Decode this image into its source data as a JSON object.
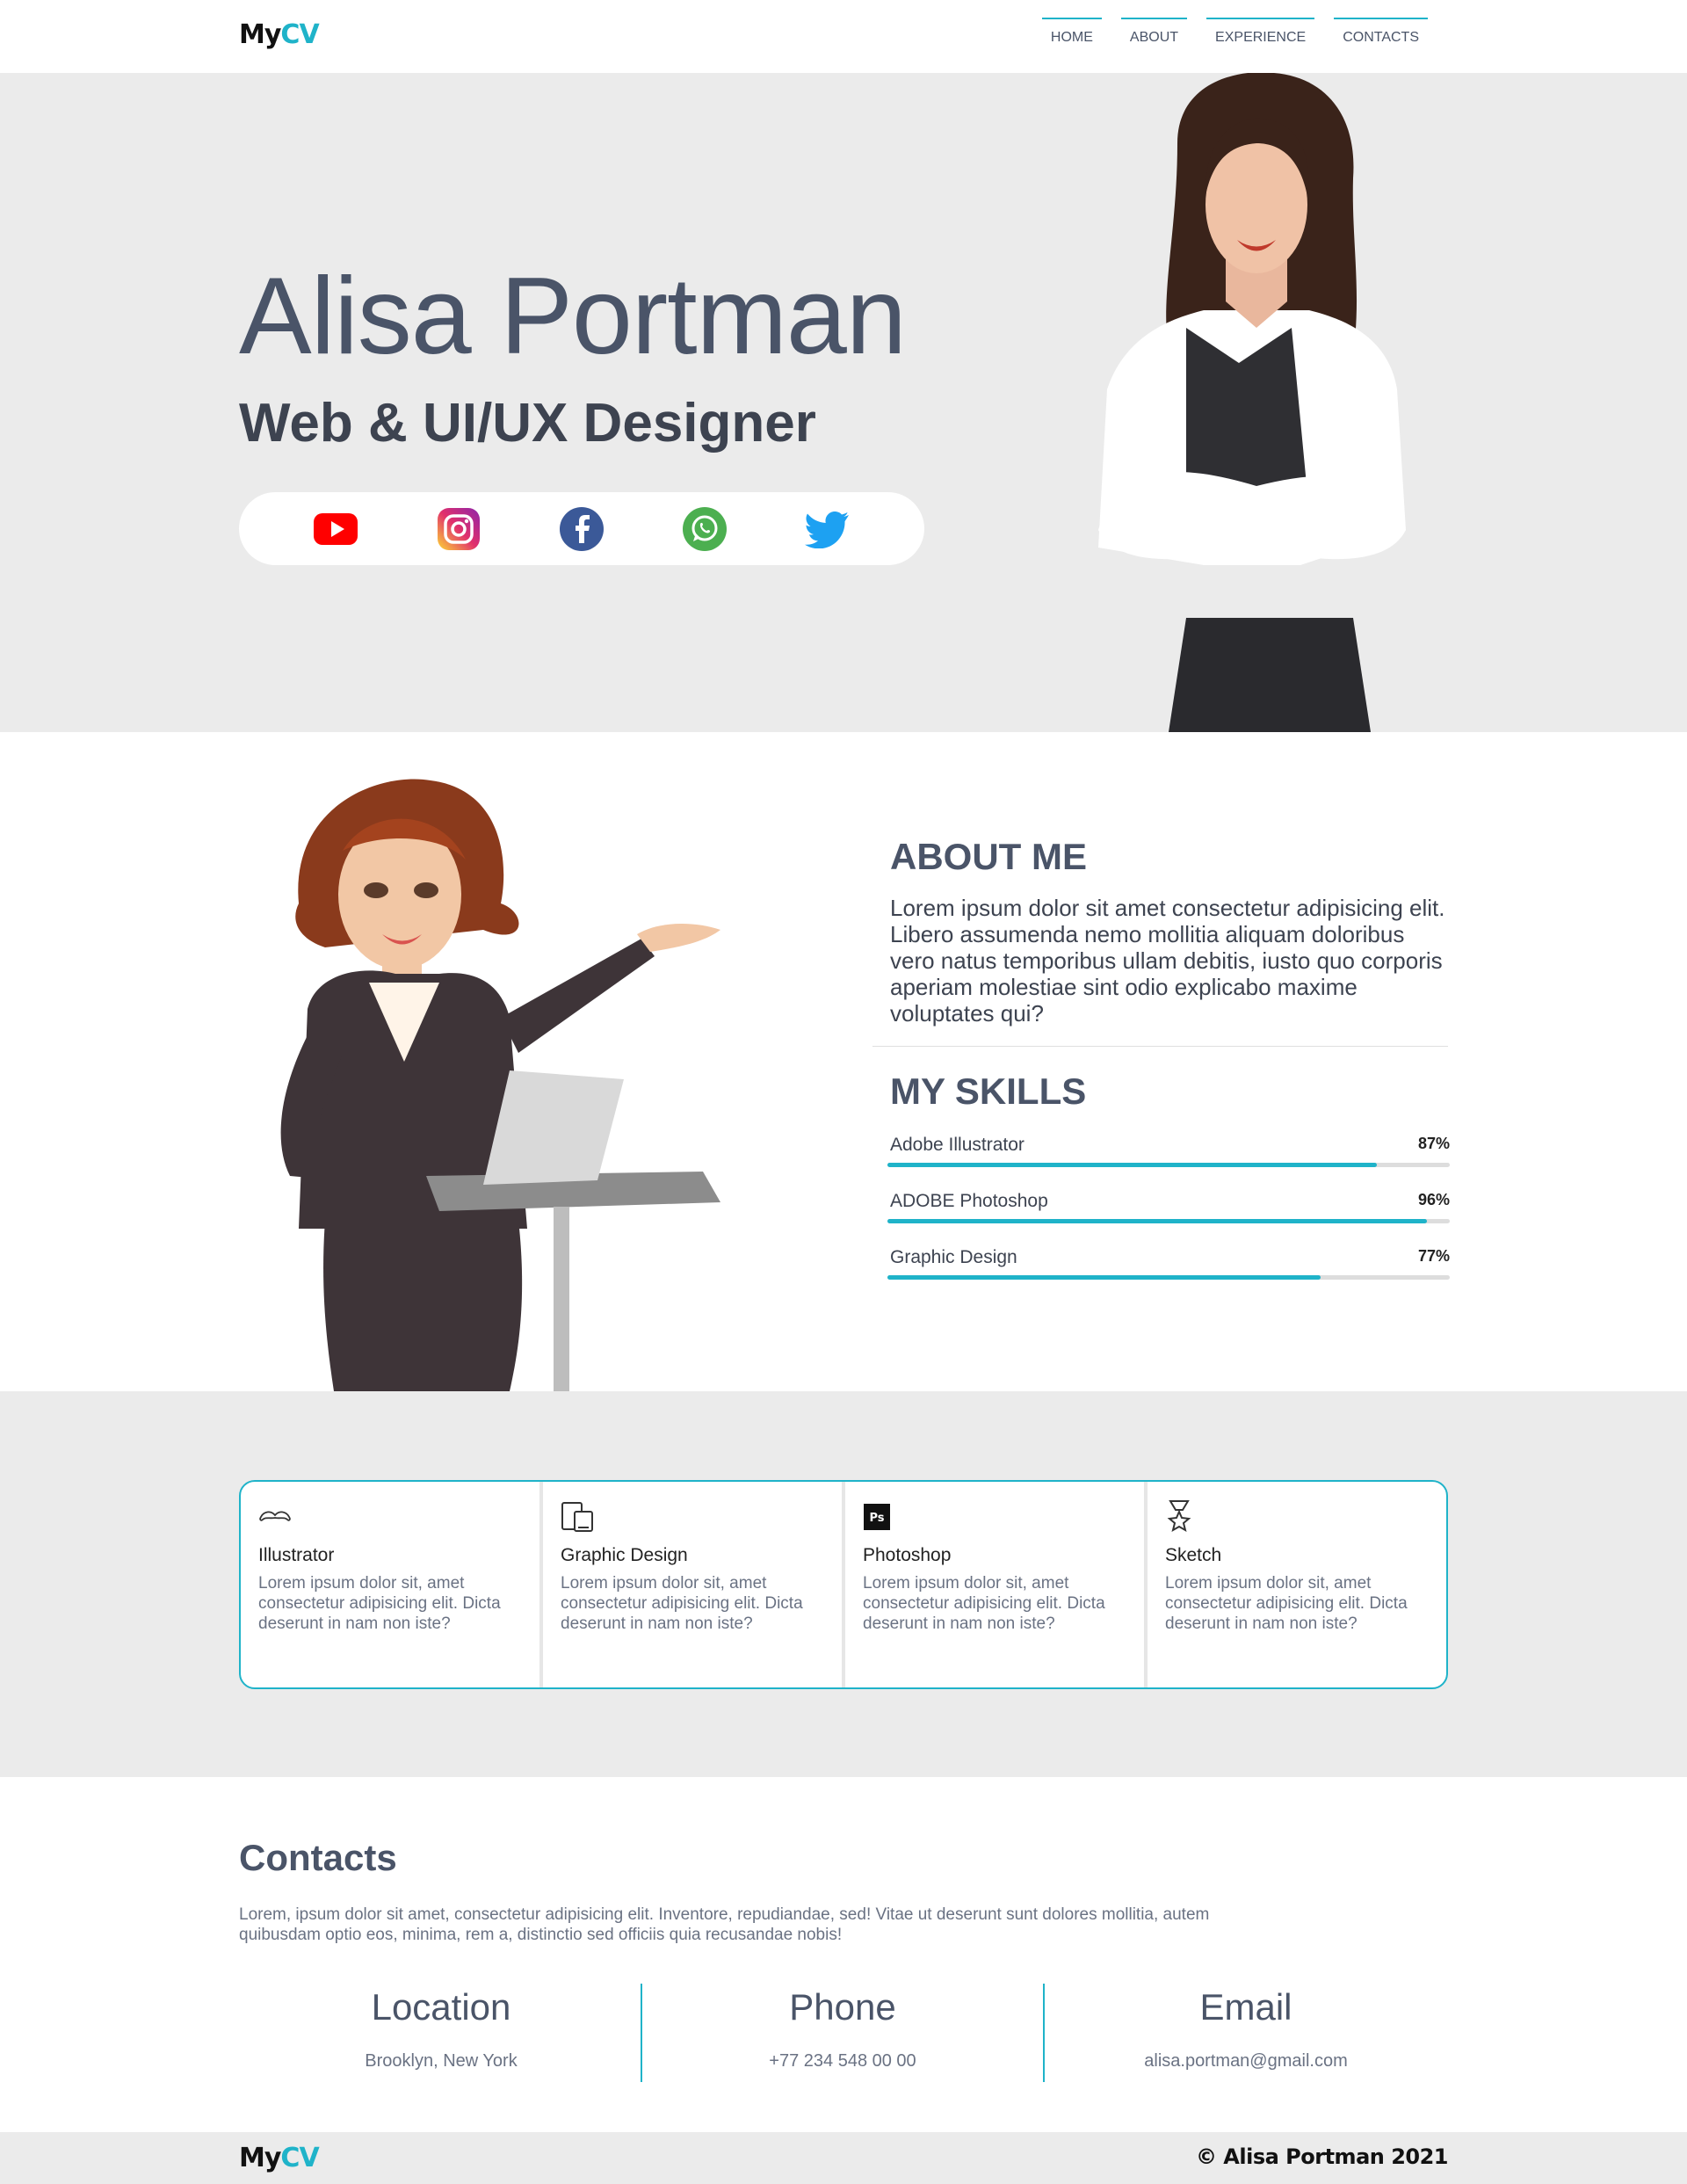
{
  "header": {
    "logo_my": "My",
    "logo_cv": "CV",
    "nav": [
      {
        "label": "HOME"
      },
      {
        "label": "ABOUT"
      },
      {
        "label": "EXPERIENCE"
      },
      {
        "label": "CONTACTS"
      }
    ]
  },
  "hero": {
    "name": "Alisa Portman",
    "title": "Web & UI/UX Designer",
    "social": [
      {
        "icon": "youtube-icon",
        "color": "#ff0000"
      },
      {
        "icon": "instagram-icon",
        "color": "#e1306c"
      },
      {
        "icon": "facebook-icon",
        "color": "#3b5998"
      },
      {
        "icon": "whatsapp-icon",
        "color": "#4caf50"
      },
      {
        "icon": "twitter-icon",
        "color": "#1da1f2"
      }
    ]
  },
  "about": {
    "heading": "ABOUT ME",
    "text": "Lorem ipsum dolor sit amet consectetur adipisicing elit. Libero assumenda nemo mollitia aliquam doloribus vero natus temporibus ullam debitis, iusto quo corporis aperiam molestiae sint odio explicabo maxime voluptates qui?",
    "skills_heading": "MY SKILLS",
    "skills": [
      {
        "label": "Adobe Illustrator",
        "percent_label": "87%",
        "value": 0.87
      },
      {
        "label": "ADOBE Photoshop",
        "percent_label": "96%",
        "value": 0.96
      },
      {
        "label": "Graphic Design",
        "percent_label": "77%",
        "value": 0.77
      }
    ]
  },
  "services": [
    {
      "icon": "mustache-icon",
      "title": "Illustrator",
      "text": "Lorem ipsum dolor sit, amet consectetur adipisicing elit. Dicta deserunt in nam non iste?"
    },
    {
      "icon": "devices-icon",
      "title": "Graphic Design",
      "text": "Lorem ipsum dolor sit, amet consectetur adipisicing elit. Dicta deserunt in nam non iste?"
    },
    {
      "icon": "photoshop-icon",
      "icon_text": "Ps",
      "title": "Photoshop",
      "text": "Lorem ipsum dolor sit, amet consectetur adipisicing elit. Dicta deserunt in nam non iste?"
    },
    {
      "icon": "award-icon",
      "title": "Sketch",
      "text": "Lorem ipsum dolor sit, amet consectetur adipisicing elit. Dicta deserunt in nam non iste?"
    }
  ],
  "contacts": {
    "heading": "Contacts",
    "text": "Lorem, ipsum dolor sit amet, consectetur adipisicing elit. Inventore, repudiandae, sed! Vitae ut deserunt sunt dolores mollitia, autem quibusdam optio eos, minima, rem a, distinctio sed officiis quia recusandae nobis!",
    "items": [
      {
        "heading": "Location",
        "value": "Brooklyn, New York"
      },
      {
        "heading": "Phone",
        "value": "+77 234 548 00 00"
      },
      {
        "heading": "Email",
        "value": "alisa.portman@gmail.com"
      }
    ]
  },
  "footer": {
    "logo_my": "My",
    "logo_cv": "CV",
    "copyright": "© Alisa Portman 2021"
  },
  "colors": {
    "accent": "#1fb3c9",
    "text": "#4a5468",
    "band": "#ebebeb"
  }
}
